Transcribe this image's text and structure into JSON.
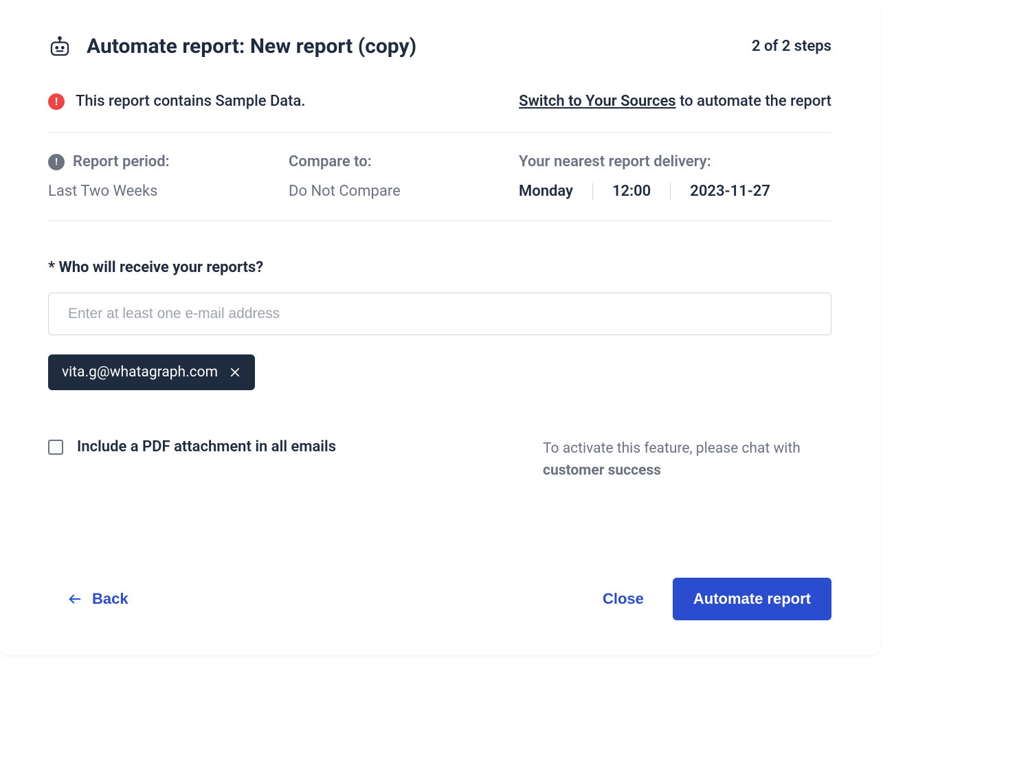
{
  "header": {
    "title": "Automate report: New report (copy)",
    "step_text": "2 of 2 steps"
  },
  "warning": {
    "text": "This report contains Sample Data.",
    "link": "Switch to Your Sources",
    "suffix": "to automate the report"
  },
  "info": {
    "period": {
      "label": "Report period:",
      "value": "Last Two Weeks"
    },
    "compare": {
      "label": "Compare to:",
      "value": "Do Not Compare"
    },
    "delivery": {
      "label": "Your nearest report delivery:",
      "day": "Monday",
      "time": "12:00",
      "date": "2023-11-27"
    }
  },
  "recipients": {
    "label": "* Who will receive your reports?",
    "placeholder": "Enter at least one e-mail address",
    "chips": [
      "vita.g@whatagraph.com"
    ]
  },
  "pdf": {
    "label": "Include a PDF attachment in all emails",
    "note_prefix": "To activate this feature, please chat with ",
    "note_strong": "customer success"
  },
  "footer": {
    "back": "Back",
    "close": "Close",
    "submit": "Automate report"
  }
}
